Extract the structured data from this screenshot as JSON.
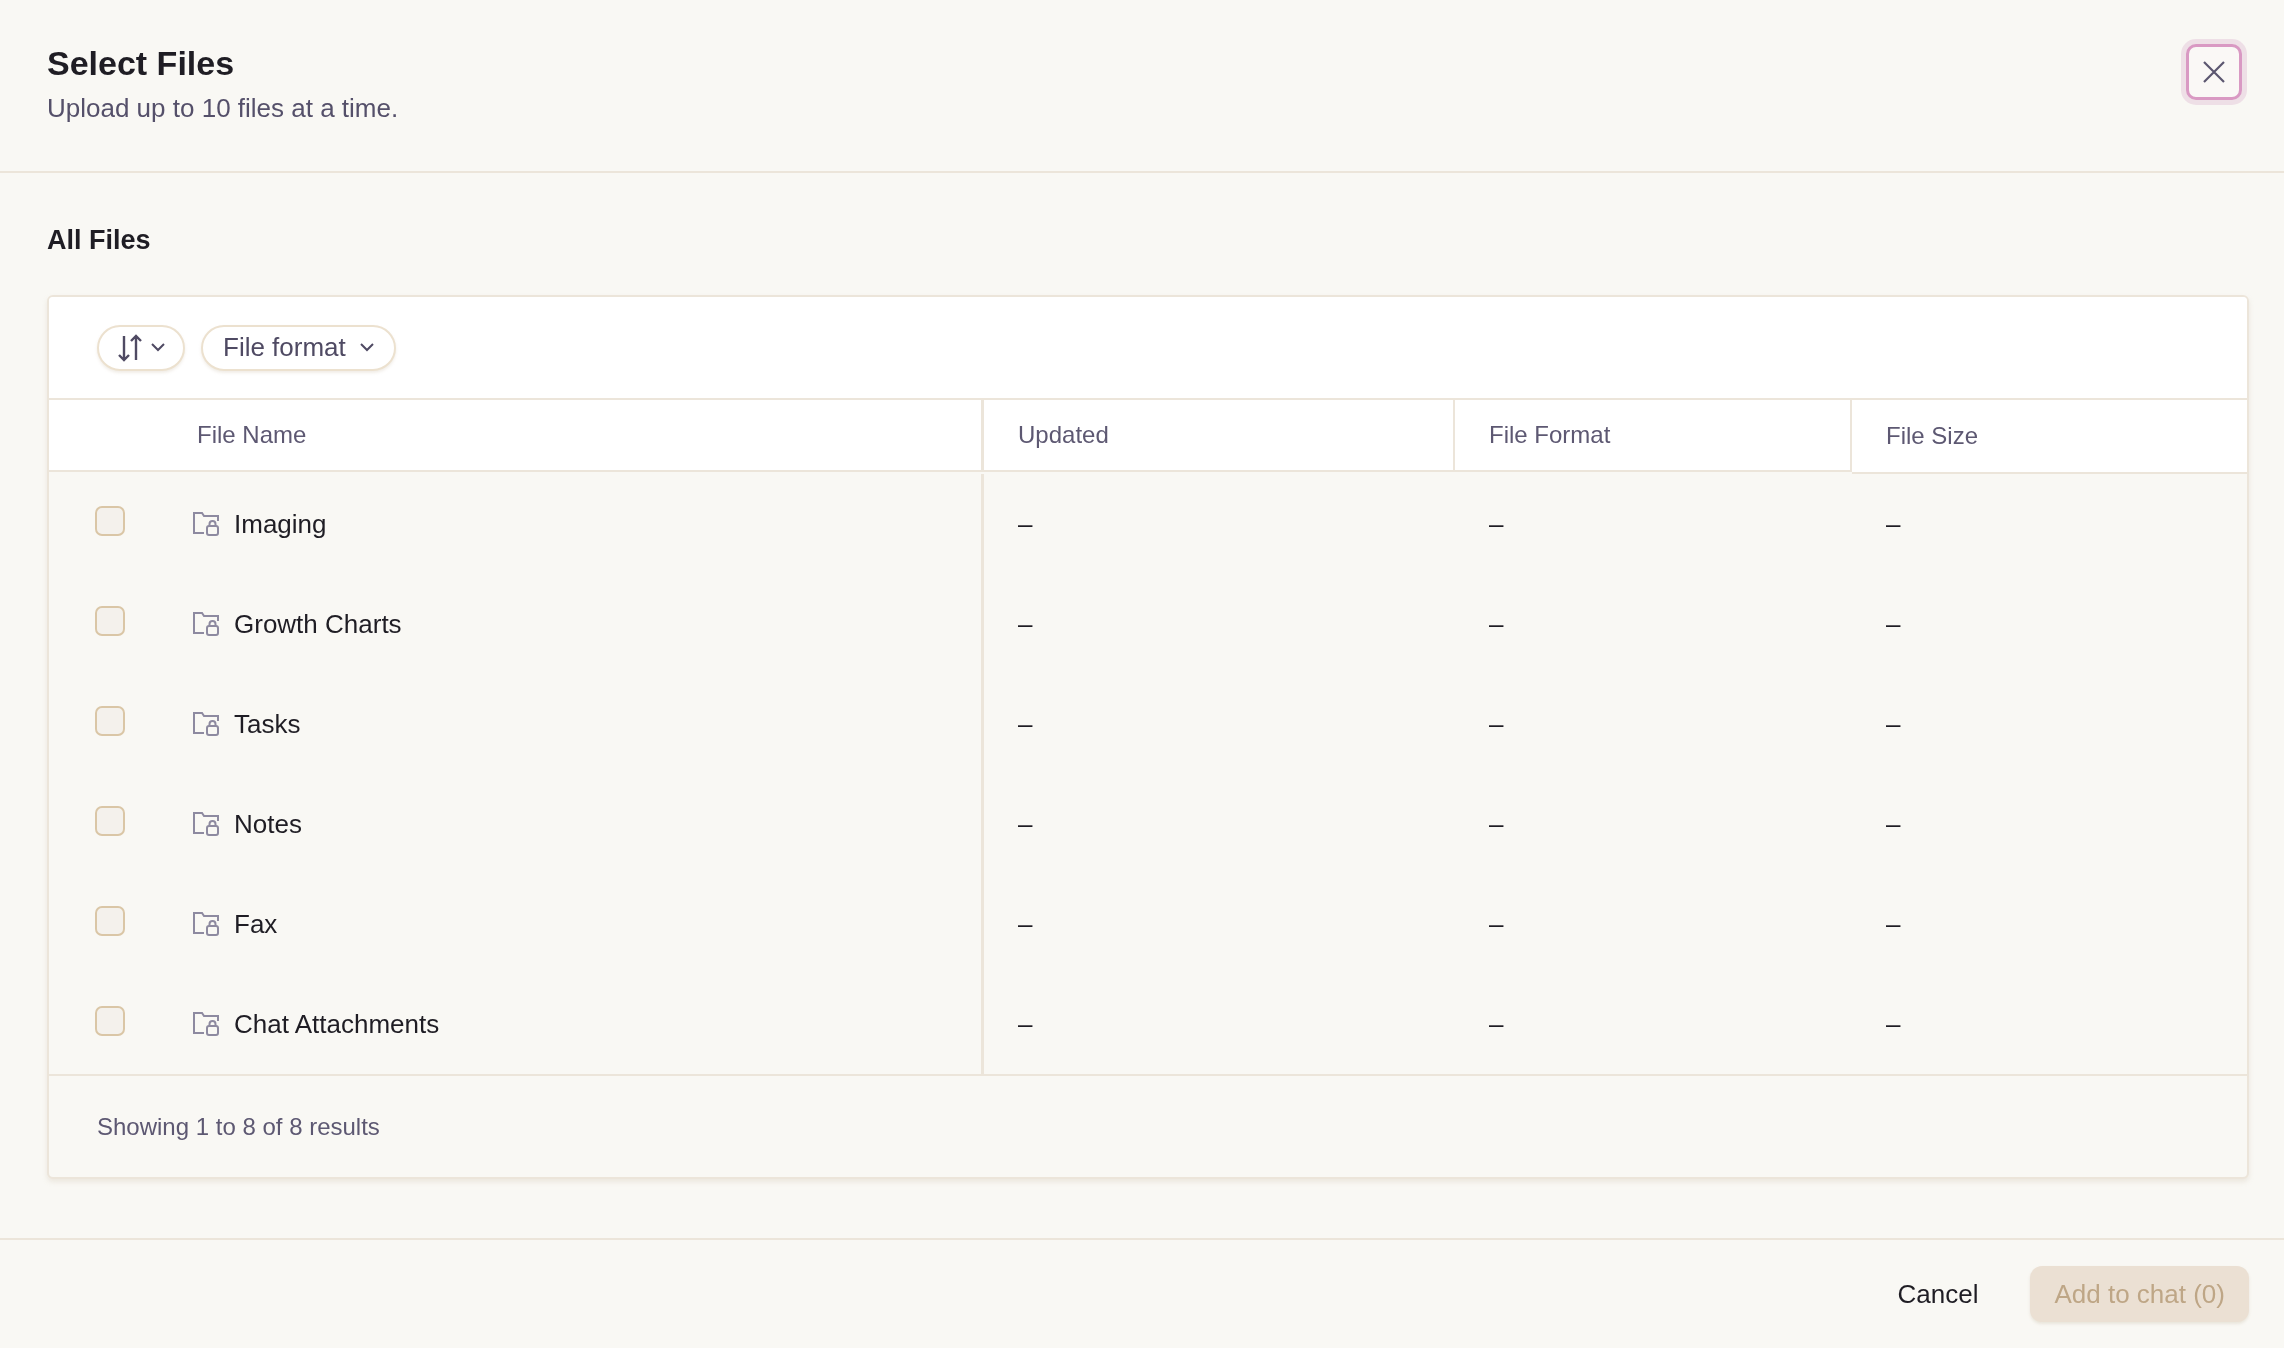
{
  "dialog": {
    "title": "Select Files",
    "subtitle": "Upload up to 10 files at a time."
  },
  "section_title": "All Files",
  "toolbar": {
    "filter_label": "File format"
  },
  "table": {
    "columns": [
      "File Name",
      "Updated",
      "File Format",
      "File Size"
    ],
    "rows": [
      {
        "name": "Imaging",
        "checked": false,
        "updated": "–",
        "format": "–",
        "size": "–"
      },
      {
        "name": "Growth Charts",
        "checked": false,
        "updated": "–",
        "format": "–",
        "size": "–"
      },
      {
        "name": "Tasks",
        "checked": false,
        "updated": "–",
        "format": "–",
        "size": "–"
      },
      {
        "name": "Notes",
        "checked": false,
        "updated": "–",
        "format": "–",
        "size": "–"
      },
      {
        "name": "Fax",
        "checked": false,
        "updated": "–",
        "format": "–",
        "size": "–"
      },
      {
        "name": "Chat Attachments",
        "checked": false,
        "updated": "–",
        "format": "–",
        "size": "–"
      }
    ]
  },
  "summary": "Showing 1 to 8 of 8 results",
  "buttons": [
    {
      "label": "Cancel",
      "kind": "text",
      "disabled": false
    },
    {
      "label": "Add to chat (0)",
      "kind": "primary",
      "disabled": true
    }
  ]
}
